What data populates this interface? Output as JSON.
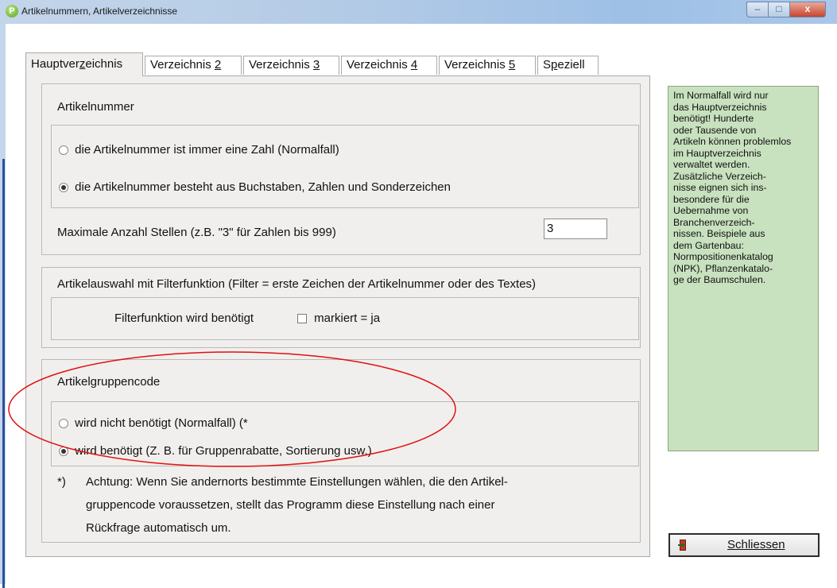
{
  "window": {
    "title": "Artikelnummern, Artikelverzeichnisse",
    "app_icon_letter": "P",
    "buttons": {
      "minimize": "–",
      "maximize": "□",
      "close": "x"
    }
  },
  "tabs": {
    "haupt": {
      "pre": "Hauptver",
      "key": "z",
      "post": "eichnis"
    },
    "v2": {
      "pre": "Verzeichnis ",
      "key": "2"
    },
    "v3": {
      "pre": "Verzeichnis ",
      "key": "3"
    },
    "v4": {
      "pre": "Verzeichnis ",
      "key": "4"
    },
    "v5": {
      "pre": "Verzeichnis ",
      "key": "5"
    },
    "speziell": {
      "pre": "S",
      "key": "p",
      "post": "eziell"
    },
    "active": "haupt"
  },
  "artikelnummer": {
    "heading": "Artikelnummer",
    "option_zahl": "die Artikelnummer ist immer eine Zahl (Normalfall)",
    "option_text": "die Artikelnummer besteht aus Buchstaben, Zahlen und Sonderzeichen",
    "selected": "option_text",
    "max_label": "Maximale Anzahl Stellen (z.B. \"3\"  für Zahlen bis 999)",
    "max_value": "3"
  },
  "filter": {
    "heading": "Artikelauswahl mit Filterfunktion (Filter = erste Zeichen der Artikelnummer oder des Textes)",
    "label": "Filterfunktion wird benötigt",
    "checkbox_label": "markiert = ja",
    "checked": false
  },
  "gruppencode": {
    "heading": "Artikelgruppencode",
    "option_nicht": "wird nicht benötigt (Normalfall) (*",
    "option_benoetigt": "wird  benötigt (Z. B. für Gruppenrabatte, Sortierung usw.)",
    "selected": "option_benoetigt",
    "note_marker": "*)",
    "note_line1": "Achtung: Wenn Sie andernorts bestimmte Einstellungen wählen, die den Artikel-",
    "note_line2": "gruppencode voraussetzen, stellt das Programm diese Einstellung nach einer",
    "note_line3": "Rückfrage automatisch um."
  },
  "info_box": {
    "lines": [
      "Im Normalfall wird nur",
      "das Hauptverzeichnis",
      "benötigt! Hunderte",
      "oder Tausende von",
      "Artikeln können problemlos",
      "im Hauptverzeichnis",
      "verwaltet werden.",
      "Zusätzliche Verzeich-",
      "nisse eignen sich ins-",
      "besondere für die",
      "Uebernahme von",
      "Branchenverzeich-",
      "nissen. Beispiele aus",
      "dem Gartenbau:",
      "Normpositionenkatalog",
      "(NPK), Pflanzenkatalo-",
      "ge der Baumschulen."
    ],
    "color": "#c8e1be"
  },
  "close_button": {
    "label": "Schliessen",
    "icon": "door-exit-icon"
  },
  "annotation": {
    "color": "#e01010"
  }
}
